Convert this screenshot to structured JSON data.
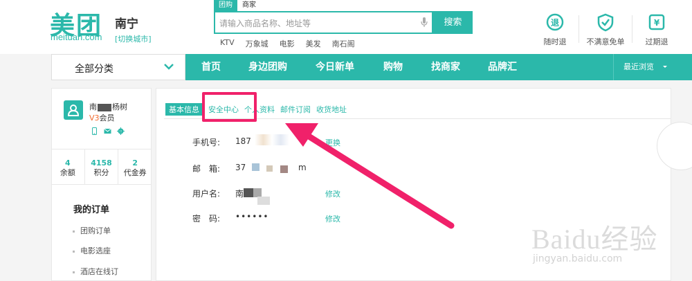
{
  "header": {
    "logo_cn": "美团",
    "logo_en": "meituan.com",
    "city": "南宁",
    "switch_city": "[切换城市]",
    "search_tabs": [
      "团购",
      "商家"
    ],
    "search_placeholder": "请输入商品名称、地址等",
    "search_button": "搜索",
    "hot_words": [
      "KTV",
      "万象城",
      "电影",
      "美发",
      "南石阁"
    ],
    "services": [
      {
        "label": "随时退",
        "icon": "refund-anytime-icon"
      },
      {
        "label": "不满意免单",
        "icon": "shield-check-icon"
      },
      {
        "label": "过期退",
        "icon": "expired-refund-icon"
      }
    ]
  },
  "nav": {
    "all_categories": "全部分类",
    "items": [
      "首页",
      "身边团购",
      "今日新单",
      "购物",
      "找商家",
      "品牌汇"
    ],
    "recent": "最近浏览"
  },
  "sidebar": {
    "user_name": "南",
    "user_name_tail": "杨树",
    "level_prefix": "V3",
    "level_suffix": "会员",
    "stats": [
      {
        "value": "4",
        "label": "余额"
      },
      {
        "value": "4158",
        "label": "积分"
      },
      {
        "value": "2",
        "label": "代金券"
      }
    ],
    "orders_title": "我的订单",
    "order_items": [
      "团购订单",
      "电影选座",
      "酒店在线订"
    ]
  },
  "main": {
    "tabs": [
      "基本信息",
      "安全中心",
      "个人资料",
      "邮件订阅",
      "收货地址"
    ],
    "fields": [
      {
        "label": "手机号:",
        "value": "187",
        "link": "更换"
      },
      {
        "label": "邮　箱:",
        "value": "37",
        "value_tail": "m",
        "link": ""
      },
      {
        "label": "用户名:",
        "value": "南",
        "link": "修改"
      },
      {
        "label": "密　码:",
        "value": "••••••",
        "link": "修改"
      }
    ]
  },
  "watermark": {
    "main": "Bai",
    "paw": "du",
    "cn": "经验",
    "url": "jingyan.baidu.com"
  },
  "colors": {
    "brand": "#2bb8aa",
    "highlight": "#f0216a",
    "level": "#f26a2e"
  }
}
